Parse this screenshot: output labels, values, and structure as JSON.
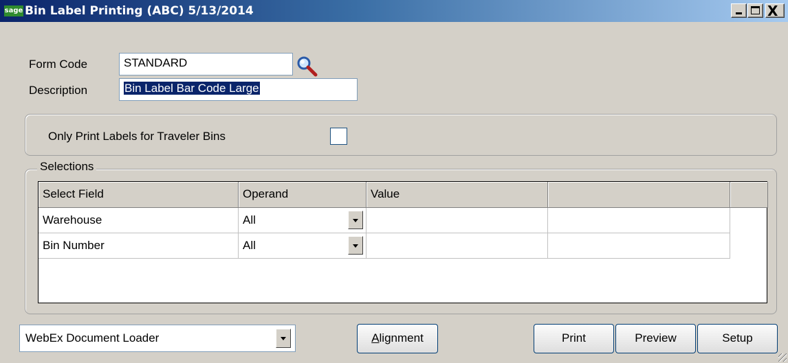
{
  "window": {
    "logo": "sage",
    "title": "Bin Label Printing (ABC) 5/13/2014",
    "buttons": [
      "minimize",
      "maximize",
      "close"
    ],
    "close_glyph": "X"
  },
  "form": {
    "form_code_label": "Form Code",
    "form_code_value": "STANDARD",
    "lookup_icon": "magnifier-icon",
    "description_label": "Description",
    "description_value": "Bin Label Bar Code Large"
  },
  "options": {
    "traveler_bins_label": "Only Print Labels for Traveler Bins",
    "traveler_bins_checked": false
  },
  "selections": {
    "legend": "Selections",
    "columns": [
      "Select Field",
      "Operand",
      "Value",
      ""
    ],
    "rows": [
      {
        "field": "Warehouse",
        "operand": "All",
        "value": "",
        "extra": ""
      },
      {
        "field": "Bin Number",
        "operand": "All",
        "value": "",
        "extra": ""
      }
    ]
  },
  "footer": {
    "printer": "WebEx Document Loader",
    "alignment_label": "Alignment",
    "alignment_accel": "A",
    "print_label": "Print",
    "preview_label": "Preview",
    "setup_label": "Setup"
  },
  "colors": {
    "titlebar_start": "#0a246a",
    "titlebar_end": "#a6caf0",
    "window_bg": "#d4d0c8",
    "selection_highlight": "#0a246a"
  }
}
